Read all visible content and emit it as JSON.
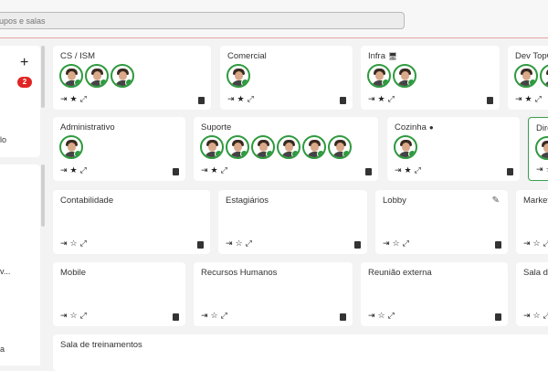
{
  "header": {
    "search_placeholder": "upos e salas"
  },
  "sidebar": {
    "badge_count": "2",
    "texts": [
      "lo",
      "v...",
      "a"
    ]
  },
  "icons": {
    "enter": "⇥",
    "star_filled": "★",
    "star_empty": "☆",
    "expand": "⤢"
  },
  "colors": {
    "presence": "#2e9a3e",
    "badge": "#e02424",
    "active_border": "#3aa14c"
  },
  "rooms": [
    {
      "id": "cs-ism",
      "title": "CS / ISM",
      "starred": true,
      "avatars": 3
    },
    {
      "id": "comercial",
      "title": "Comercial",
      "starred": true,
      "avatars": 1
    },
    {
      "id": "infra",
      "title": "Infra",
      "flag": "🖥",
      "starred": true,
      "avatars": 2
    },
    {
      "id": "dev",
      "title": "Dev TopGe",
      "starred": true,
      "avatars": 2
    },
    {
      "id": "administrativo",
      "title": "Administrativo",
      "starred": true,
      "avatars": 1
    },
    {
      "id": "suporte",
      "title": "Suporte",
      "starred": true,
      "avatars": 6
    },
    {
      "id": "cozinha",
      "title": "Cozinha",
      "flag": "●",
      "starred": true,
      "avatars": 1
    },
    {
      "id": "dire",
      "title": "Dire",
      "starred": false,
      "avatars": 1
    },
    {
      "id": "contabilidade",
      "title": "Contabilidade",
      "starred": false,
      "avatars": 0
    },
    {
      "id": "estagiarios",
      "title": "Estagiários",
      "starred": false,
      "avatars": 0
    },
    {
      "id": "lobby",
      "title": "Lobby",
      "starred": false,
      "avatars": 0
    },
    {
      "id": "marketi",
      "title": "Marketi",
      "starred": false,
      "avatars": 0
    },
    {
      "id": "mobile",
      "title": "Mobile",
      "starred": false,
      "avatars": 0
    },
    {
      "id": "rh",
      "title": "Recursos Humanos",
      "starred": false,
      "avatars": 0
    },
    {
      "id": "reuniao",
      "title": "Reunião externa",
      "starred": false,
      "avatars": 0
    },
    {
      "id": "sala-d",
      "title": "Sala de",
      "starred": false,
      "avatars": 0
    },
    {
      "id": "treinamentos",
      "title": "Sala de treinamentos",
      "starred": false,
      "avatars": 0
    }
  ]
}
